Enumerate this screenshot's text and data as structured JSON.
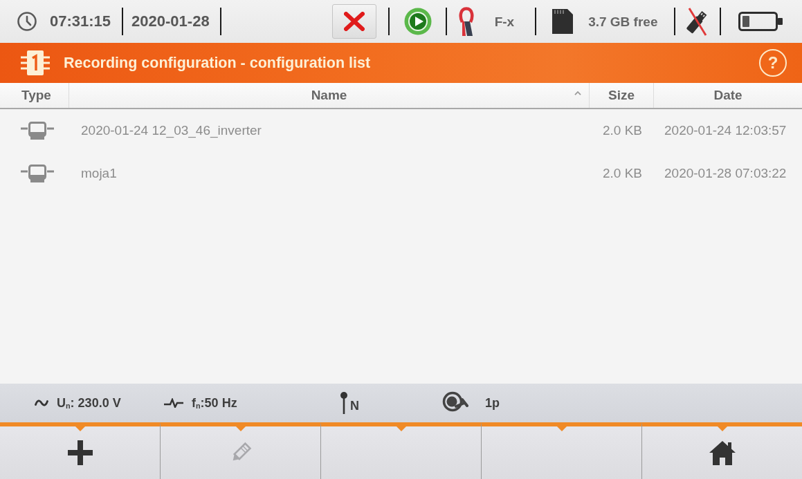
{
  "status_bar": {
    "time": "07:31:15",
    "date": "2020-01-28",
    "clamp_label": "F-x",
    "storage": "3.7 GB free"
  },
  "title_bar": {
    "title": "Recording configuration - configuration list",
    "help_label": "?"
  },
  "table": {
    "columns": [
      {
        "label": "Type",
        "sorted": false
      },
      {
        "label": "Name",
        "sorted": true
      },
      {
        "label": "Size",
        "sorted": false
      },
      {
        "label": "Date",
        "sorted": false
      }
    ],
    "rows": [
      {
        "name": "2020-01-24 12_03_46_inverter",
        "size": "2.0 KB",
        "date": "2020-01-24 12:03:57",
        "selected": false
      },
      {
        "name": "moja1",
        "size": "2.0 KB",
        "date": "2020-01-28 07:03:22",
        "selected": false
      }
    ]
  },
  "info_bar": [
    {
      "kind": "voltage",
      "text": "U$_{n}$: 230.0 V"
    },
    {
      "kind": "frequency",
      "text": "f$_{n}$:50 Hz"
    },
    {
      "kind": "neutral",
      "text": "N"
    },
    {
      "kind": "clamp",
      "text": "1p"
    }
  ],
  "function_keys": [
    {
      "kind": "add",
      "disabled": false
    },
    {
      "kind": "edit",
      "disabled": true
    },
    {
      "kind": "blank"
    },
    {
      "kind": "blank"
    },
    {
      "kind": "home",
      "disabled": false
    }
  ]
}
